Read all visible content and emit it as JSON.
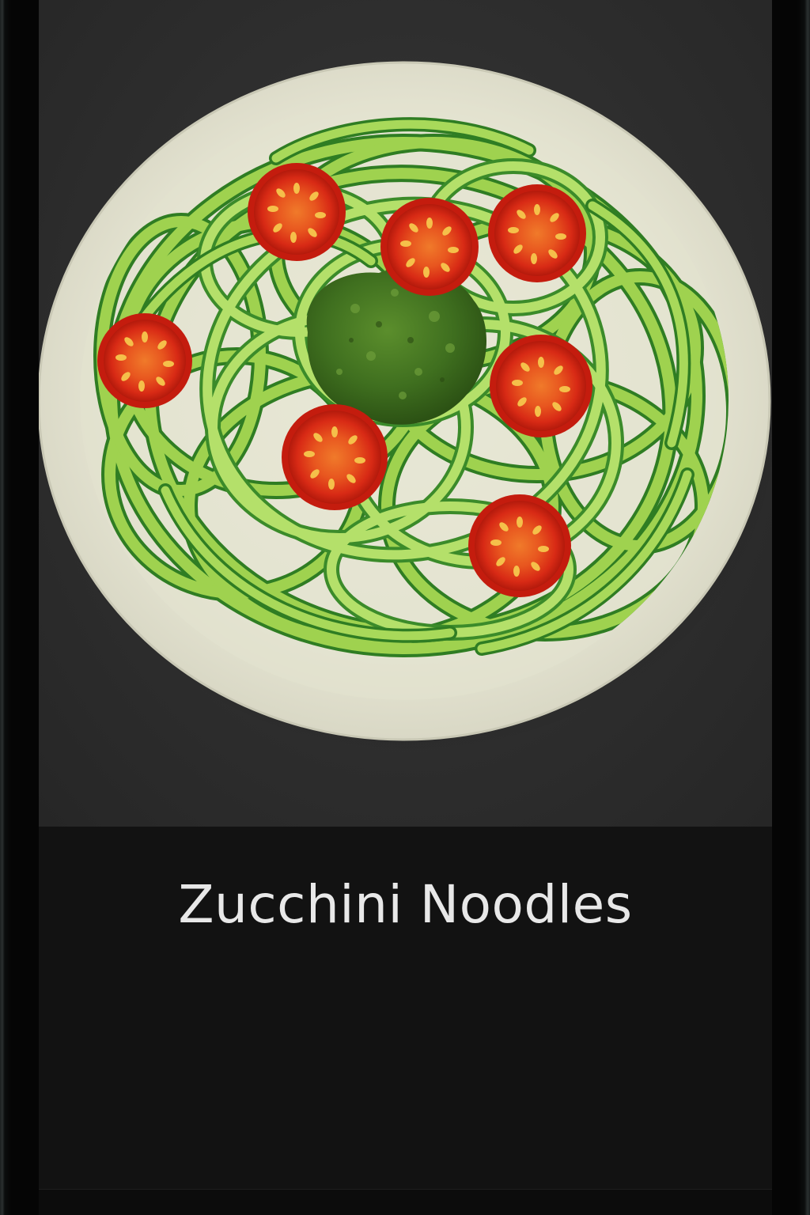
{
  "card": {
    "title": "Zucchini Noodles"
  },
  "photo": {
    "subject": "zucchini-noodles-dish",
    "colors": {
      "background": "#2e2e2e",
      "plate": "#e9e8d8",
      "noodle": "#9ccf4a",
      "noodle_skin": "#2f7d23",
      "pesto": "#3f6f1f",
      "tomato": "#d92a16"
    }
  }
}
